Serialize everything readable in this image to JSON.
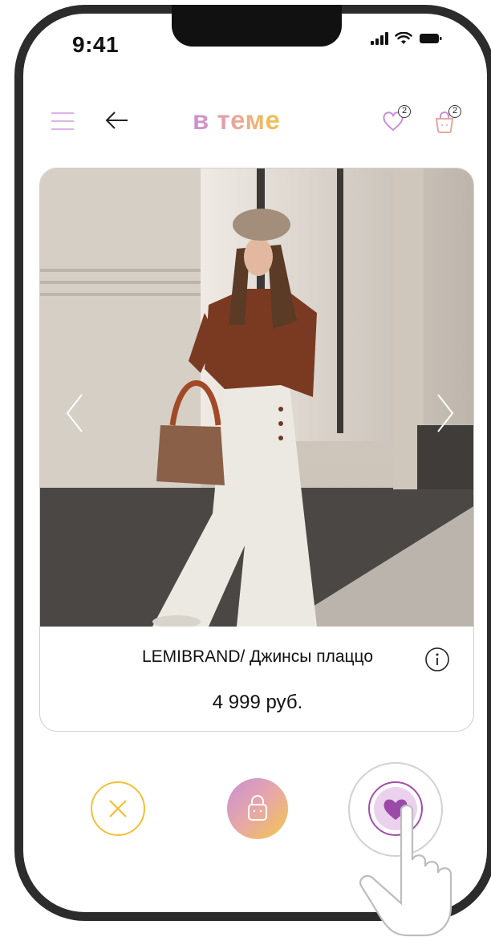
{
  "status_bar": {
    "time": "9:41"
  },
  "header": {
    "brand": "в теме",
    "wishlist_count": "2",
    "cart_count": "2",
    "icons": {
      "menu": "hamburger-menu-icon",
      "back": "arrow-left-icon",
      "wishlist": "heart-icon",
      "cart": "shopping-bag-icon"
    }
  },
  "product": {
    "title": "LEMIBRAND/ Джинсы плаццо",
    "price": "4 999 руб.",
    "image_alt": "product-photo"
  },
  "actions": {
    "dislike_icon": "close-x-icon",
    "cart_icon": "shopping-bag-icon",
    "like_icon": "heart-icon"
  },
  "colors": {
    "accent_purple": "#c98fd6",
    "accent_peach": "#e8a6a0",
    "accent_yellow": "#f2c14a",
    "like_purple": "#a14fa8",
    "dislike_yellow": "#f4c033"
  }
}
